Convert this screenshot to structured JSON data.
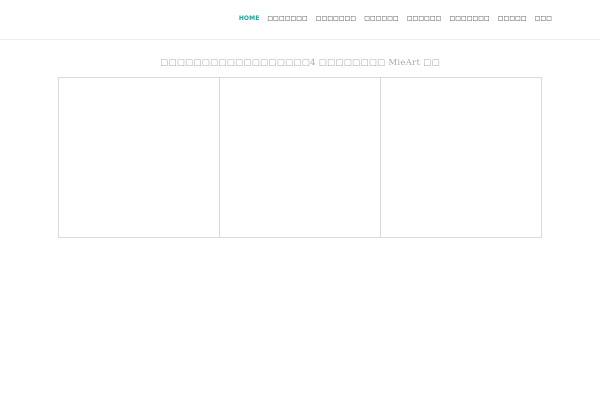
{
  "header": {
    "nav_items": [
      "HOME",
      "□□□□□□□",
      "□□□□□□□",
      "□□□□□□",
      "□□□□□□",
      "□□□□□□□",
      "□□□□□",
      "□□□"
    ]
  },
  "main": {
    "section_title": "□□□□□□□□□□□□□□□□□□4 □□□□□□□□ MieArt □□"
  },
  "colors": {
    "accent": "#1aa39a",
    "nav_text": "#333333",
    "title_text": "#a8a8a8",
    "border": "#dadada"
  }
}
